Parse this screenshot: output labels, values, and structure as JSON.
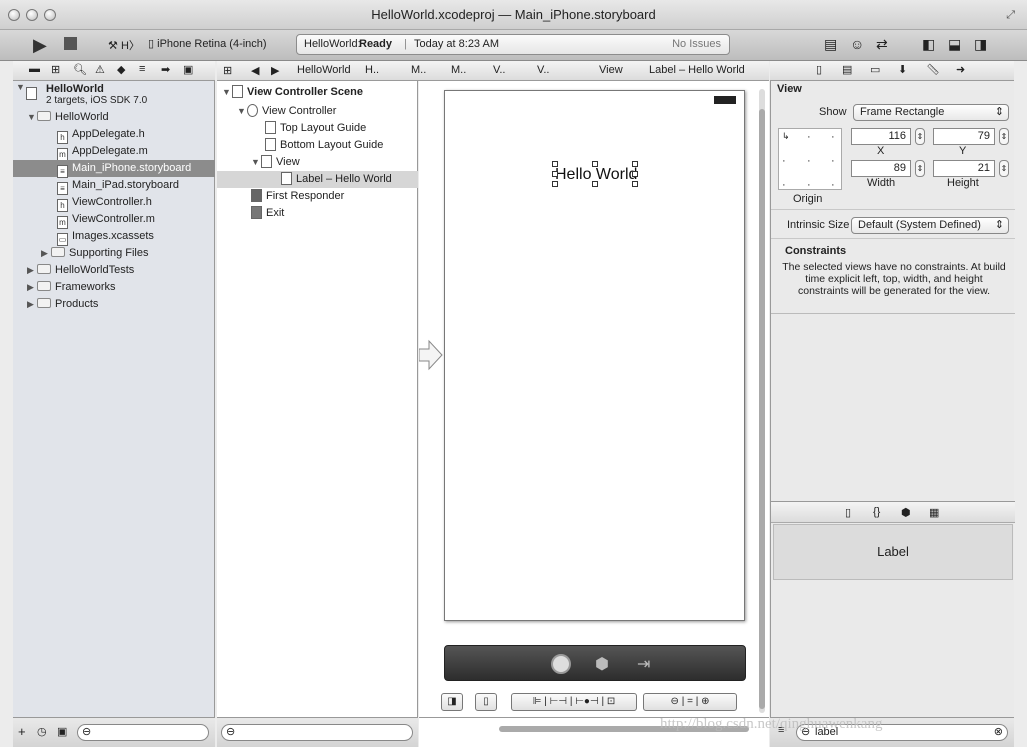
{
  "window": {
    "title": "HelloWorld.xcodeproj — Main_iPhone.storyboard"
  },
  "toolbar": {
    "scheme": "H〉",
    "device": "iPhone Retina (4-inch)",
    "status_project": "HelloWorld:",
    "status_state": "Ready",
    "status_time": "Today at 8:23 AM",
    "status_issues": "No Issues"
  },
  "navigator": {
    "project": "HelloWorld",
    "project_sub": "2 targets, iOS SDK 7.0",
    "items": [
      {
        "label": "HelloWorld",
        "icon": "folder-icon"
      },
      {
        "label": "AppDelegate.h",
        "badge": "h"
      },
      {
        "label": "AppDelegate.m",
        "badge": "m"
      },
      {
        "label": "Main_iPhone.storyboard",
        "badge": "≡"
      },
      {
        "label": "Main_iPad.storyboard",
        "badge": "≡"
      },
      {
        "label": "ViewController.h",
        "badge": "h"
      },
      {
        "label": "ViewController.m",
        "badge": "m"
      },
      {
        "label": "Images.xcassets",
        "badge": "▭"
      },
      {
        "label": "Supporting Files",
        "icon": "folder-icon"
      },
      {
        "label": "HelloWorldTests",
        "icon": "folder-icon"
      },
      {
        "label": "Frameworks",
        "icon": "folder-icon"
      },
      {
        "label": "Products",
        "icon": "folder-icon"
      }
    ]
  },
  "jumpbar": {
    "items": [
      "HelloWorld",
      "H..",
      "M..",
      "M..",
      "V..",
      "V..",
      "View",
      "Label – Hello World"
    ]
  },
  "outline": {
    "scene": "View Controller Scene",
    "vc": "View Controller",
    "top_guide": "Top Layout Guide",
    "bottom_guide": "Bottom Layout Guide",
    "view": "View",
    "label": "Label – Hello World",
    "responder": "First Responder",
    "exit": "Exit"
  },
  "canvas": {
    "label_text": "Hello World"
  },
  "inspector": {
    "section": "View",
    "show_label": "Show",
    "show_value": "Frame Rectangle",
    "x": "116",
    "y": "79",
    "x_label": "X",
    "y_label": "Y",
    "width": "89",
    "height": "21",
    "width_label": "Width",
    "height_label": "Height",
    "origin_label": "Origin",
    "intrinsic_label": "Intrinsic Size",
    "intrinsic_value": "Default (System Defined)",
    "constraints_title": "Constraints",
    "constraints_text": "The selected views have no constraints. At build time explicit left, top, width, and height constraints will be generated for the view."
  },
  "library": {
    "item": "Label",
    "search": "label"
  },
  "watermark": "http://blog.csdn.net/qinghuawenkang"
}
